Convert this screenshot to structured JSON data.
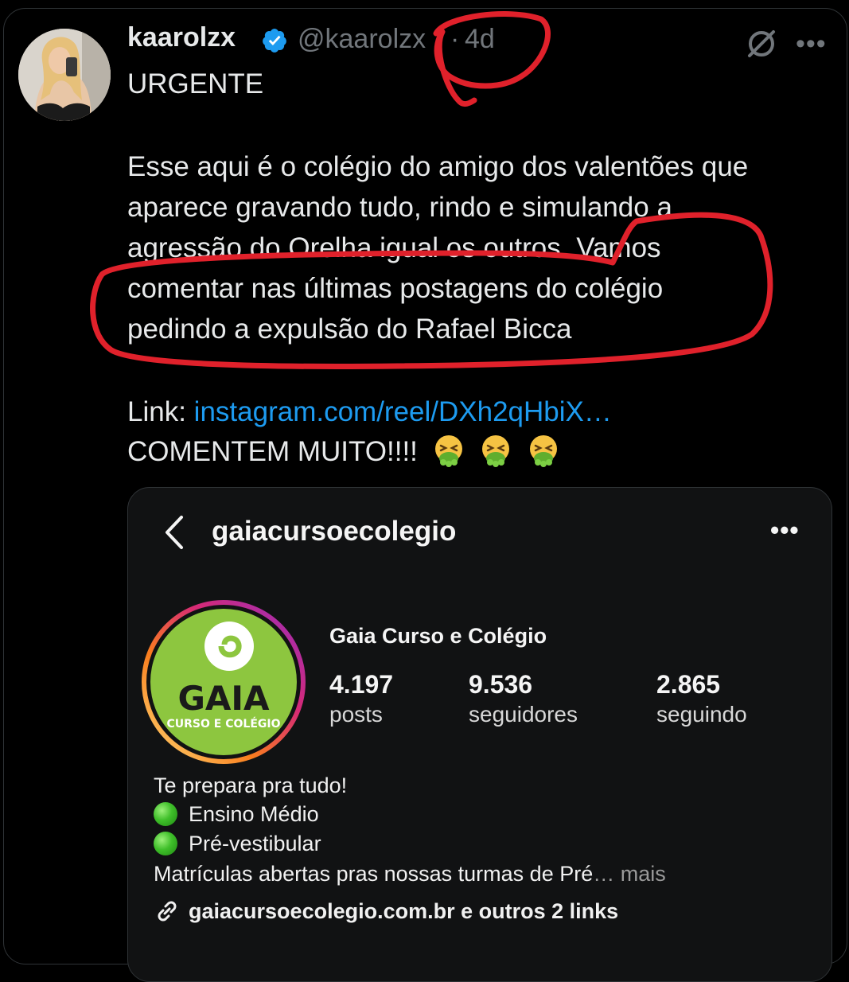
{
  "tweet": {
    "display_name": "kaarolzx",
    "handle": "@kaarolzx",
    "separator": "·",
    "time": "4d",
    "lines": [
      "URGENTE",
      "",
      "Esse aqui é o colégio do amigo dos valentões que",
      "aparece gravando tudo, rindo e simulando a",
      "agressão do Orelha igual os outros. Vamos",
      "comentar nas últimas postagens do colégio",
      "pedindo a expulsão do Rafael Bicca",
      "",
      "Link:",
      "COMENTEM MUITO!!!!"
    ],
    "link_text": "instagram.com/reel/DXh2qHbiX…",
    "icons": [
      "verified-badge-icon",
      "grok-icon",
      "more-options-icon",
      "nauseated-face-emoji"
    ]
  },
  "embed": {
    "username": "gaiacursoecolegio",
    "profile_name": "Gaia Curso e Colégio",
    "avatar_text": "GAIA",
    "avatar_subtext": "CURSO E COLÉGIO",
    "stats": [
      {
        "value": "4.197",
        "label": "posts"
      },
      {
        "value": "9.536",
        "label": "seguidores"
      },
      {
        "value": "2.865",
        "label": "seguindo"
      }
    ],
    "bio": {
      "tagline": "Te prepara pra tudo!",
      "item1": "Ensino Médio",
      "item2": "Pré-vestibular",
      "enrollment": "Matrículas abertas pras nossas turmas de Pré",
      "ellipsis": "…",
      "more": "mais",
      "links": "gaiacursoecolegio.com.br e outros 2 links"
    },
    "icons": [
      "back-chevron-icon",
      "more-options-icon",
      "link-icon"
    ]
  },
  "colors": {
    "background": "#000000",
    "text": "#e7e9ea",
    "muted": "#71767b",
    "link": "#1d9bf0",
    "verified": "#1d9bf0",
    "annotation": "#e0212b",
    "gaia_green": "#8dc63f"
  }
}
